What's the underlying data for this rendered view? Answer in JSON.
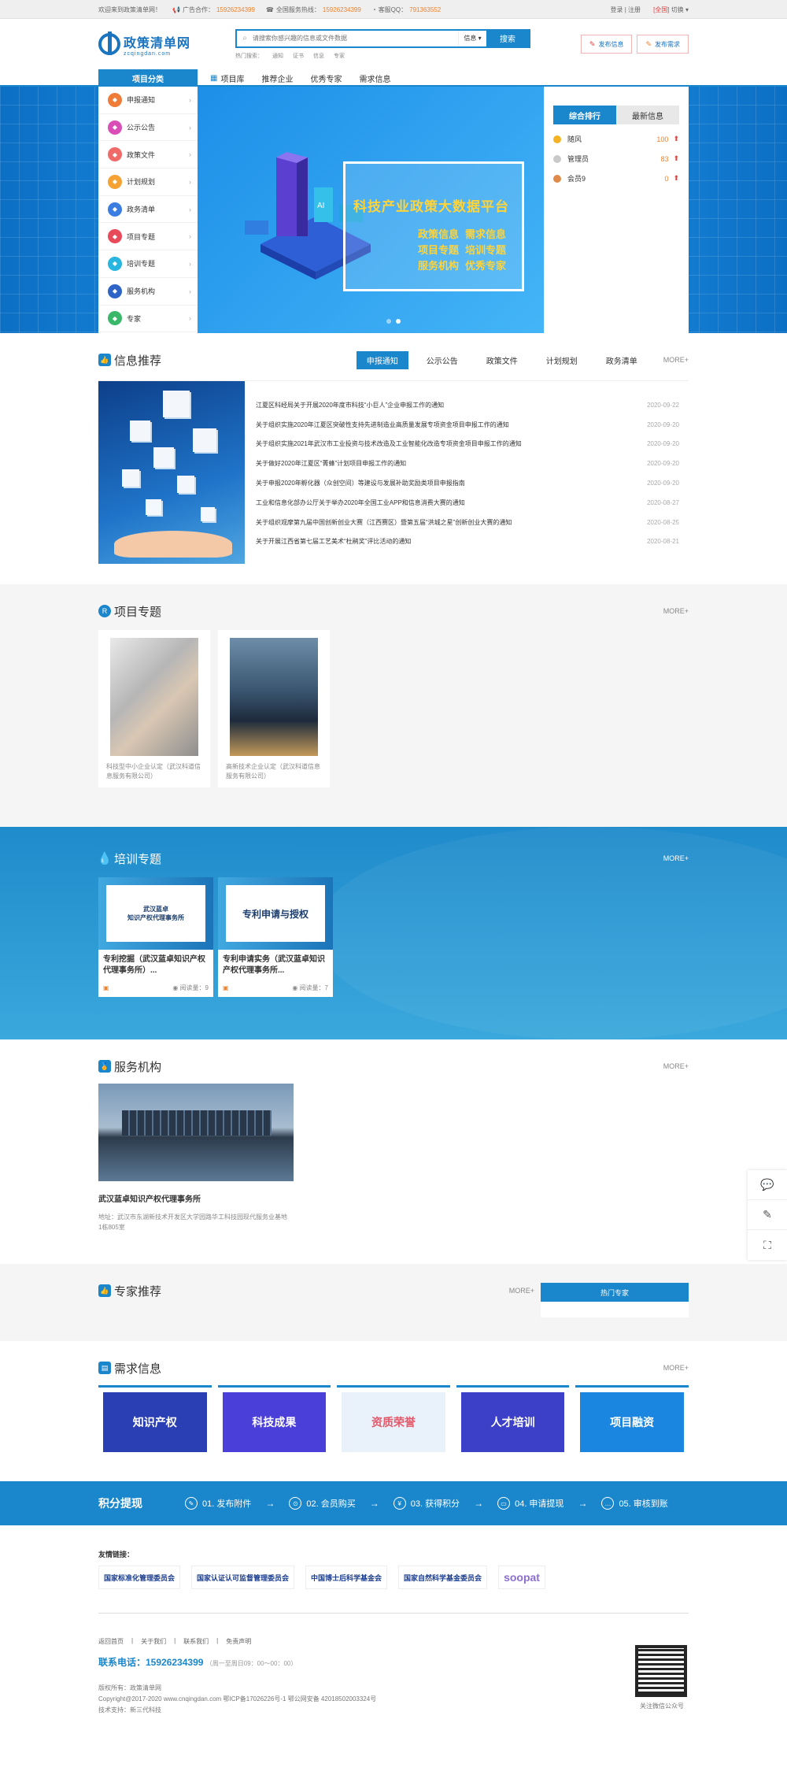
{
  "topbar": {
    "welcome": "欢迎来到政策清单网！",
    "ad_label": "广告合作：",
    "ad_phone": "15926234399",
    "service_label": "全国服务热线：",
    "service_phone": "15926234399",
    "qq_label": "客服QQ：",
    "qq": "791363552",
    "login": "登录 | 注册",
    "region": "[全国]",
    "switch": "切换"
  },
  "logo": {
    "cn": "政策清单网",
    "en": "zcqingdan.com"
  },
  "search": {
    "placeholder": "请搜索你感兴趣的信息或文件数据",
    "type": "信息 ▾",
    "button": "搜索",
    "hot_label": "热门搜索：",
    "hot": [
      "通知",
      "证书",
      "信息",
      "专家"
    ]
  },
  "publish": {
    "info": "发布信息",
    "demand": "发布需求"
  },
  "nav": {
    "category": "项目分类",
    "links": [
      "项目库",
      "推荐企业",
      "优秀专家",
      "需求信息"
    ]
  },
  "side_menu": [
    {
      "label": "申报通知",
      "color": "#f07c3a"
    },
    {
      "label": "公示公告",
      "color": "#d94fb7"
    },
    {
      "label": "政策文件",
      "color": "#f06a6a"
    },
    {
      "label": "计划规划",
      "color": "#f5a133"
    },
    {
      "label": "政务清单",
      "color": "#3b7de0"
    },
    {
      "label": "项目专题",
      "color": "#e84a5a"
    },
    {
      "label": "培训专题",
      "color": "#28b5e0"
    },
    {
      "label": "服务机构",
      "color": "#2f64c7"
    },
    {
      "label": "专家",
      "color": "#39b86a"
    }
  ],
  "hero": {
    "title": "科技产业政策大数据平台",
    "tags": [
      "政策信息",
      "需求信息",
      "项目专题",
      "培训专题",
      "服务机构",
      "优秀专家"
    ]
  },
  "rank": {
    "tabs": [
      "综合排行",
      "最新信息"
    ],
    "rows": [
      {
        "name": "随风",
        "num": "100",
        "color": "#f5b324"
      },
      {
        "name": "管理员",
        "num": "83",
        "color": "#c9c9c9"
      },
      {
        "name": "会员9",
        "num": "0",
        "color": "#e08a4a"
      }
    ]
  },
  "info": {
    "title": "信息推荐",
    "tabs": [
      "申报通知",
      "公示公告",
      "政策文件",
      "计划规划",
      "政务清单"
    ],
    "more": "MORE+",
    "rows": [
      {
        "t": "江夏区科经局关于开展2020年度市科技“小巨人”企业申报工作的通知",
        "d": "2020-09-22"
      },
      {
        "t": "关于组织实施2020年江夏区突破性支持先进制造业高质量发展专项资金项目申报工作的通知",
        "d": "2020-09-20"
      },
      {
        "t": "关于组织实施2021年武汉市工业投资与技术改造及工业智能化改造专项资金项目申报工作的通知",
        "d": "2020-09-20"
      },
      {
        "t": "关于做好2020年江夏区“菁蜂”计划项目申报工作的通知",
        "d": "2020-09-20"
      },
      {
        "t": "关于申报2020年孵化器（众创空间）等建设与发展补助奖励类项目申报指南",
        "d": "2020-09-20"
      },
      {
        "t": "工业和信息化部办公厅关于举办2020年全国工业APP和信息消费大赛的通知",
        "d": "2020-08-27"
      },
      {
        "t": "关于组织观摩第九届中国创新创业大赛（江西赛区）暨第五届“洪城之星”创新创业大赛的通知",
        "d": "2020-08-25"
      },
      {
        "t": "关于开展江西省第七届工艺美术“杜鹃奖”评比活动的通知",
        "d": "2020-08-21"
      }
    ]
  },
  "project": {
    "title": "项目专题",
    "more": "MORE+",
    "cards": [
      {
        "cap": "科技型中小企业认定（武汉科道信息服务有限公司）"
      },
      {
        "cap": "高新技术企业认定（武汉科道信息服务有限公司）"
      }
    ]
  },
  "train": {
    "title": "培训专题",
    "more": "MORE+",
    "cards": [
      {
        "cover1": "武汉蓝卓",
        "cover2": "知识产权代理事务所",
        "title": "专利挖掘（武汉蓝卓知识产权代理事务所）...",
        "views": "阅读量：9"
      },
      {
        "cover1": "专利申请与授权",
        "cover2": "",
        "title": "专利申请实务（武汉蓝卓知识产权代理事务所...",
        "views": "阅读量：7"
      }
    ]
  },
  "service": {
    "title": "服务机构",
    "more": "MORE+",
    "name": "武汉蓝卓知识产权代理事务所",
    "addr": "地址：武汉市东湖新技术开发区大学园路华工科技园现代服务业基地1栋805室"
  },
  "expert": {
    "title": "专家推荐",
    "more": "MORE+",
    "hot": "热门专家"
  },
  "demand": {
    "title": "需求信息",
    "more": "MORE+",
    "cards": [
      {
        "label": "知识产权",
        "bg": "#2b3fb5"
      },
      {
        "label": "科技成果",
        "bg": "#4a3fd8"
      },
      {
        "label": "资质荣誉",
        "bg": "#e9f1fb"
      },
      {
        "label": "人才培训",
        "bg": "#3c40c8"
      },
      {
        "label": "项目融资",
        "bg": "#1a86e0"
      }
    ]
  },
  "points": {
    "title": "积分提现",
    "steps": [
      "01. 发布附件",
      "02. 会员购买",
      "03. 获得积分",
      "04. 申请提现",
      "05. 审核到账"
    ]
  },
  "flink": {
    "title": "友情链接：",
    "logos": [
      "国家标准化管理委员会",
      "国家认证认可监督管理委员会",
      "中国博士后科学基金会",
      "国家自然科学基金委员会",
      "soopat"
    ]
  },
  "footer": {
    "links": [
      "返回首页",
      "关于我们",
      "联系我们",
      "免责声明"
    ],
    "phone": "联系电话：15926234399",
    "hours": "（周一至周日09：00～00：00）",
    "copy1": "版权所有：政策清单网",
    "copy2": "Copyright@2017-2020  www.cnqingdan.com  鄂ICP备17026226号-1  鄂公网安备 42018502003324号",
    "copy3": "技术支持：新三代科技",
    "qr_cap": "关注微信公众号"
  }
}
